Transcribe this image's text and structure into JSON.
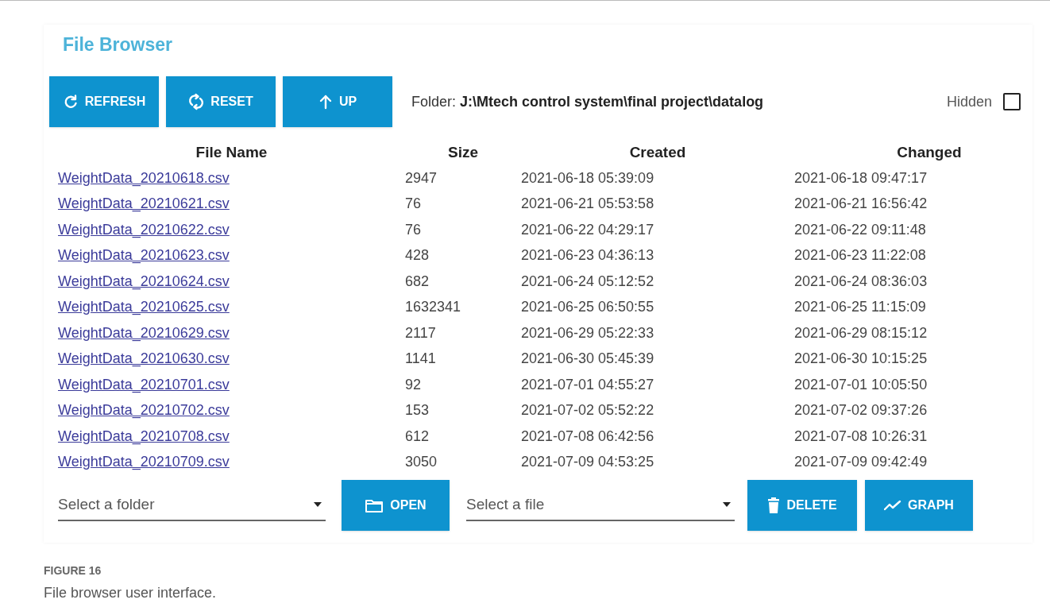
{
  "title": "File Browser",
  "toolbar": [
    {
      "label": "REFRESH"
    },
    {
      "label": "RESET"
    },
    {
      "label": "UP"
    }
  ],
  "folder": {
    "label": "Folder:",
    "path": "J:\\Mtech control system\\final project\\datalog"
  },
  "hidden": {
    "label": "Hidden",
    "checked": false
  },
  "table": {
    "columns": [
      "File Name",
      "Size",
      "Created",
      "Changed"
    ],
    "rows": [
      [
        "WeightData_20210618.csv",
        "2947",
        "2021-06-18 05:39:09",
        "2021-06-18 09:47:17"
      ],
      [
        "WeightData_20210621.csv",
        "76",
        "2021-06-21 05:53:58",
        "2021-06-21 16:56:42"
      ],
      [
        "WeightData_20210622.csv",
        "76",
        "2021-06-22 04:29:17",
        "2021-06-22 09:11:48"
      ],
      [
        "WeightData_20210623.csv",
        "428",
        "2021-06-23 04:36:13",
        "2021-06-23 11:22:08"
      ],
      [
        "WeightData_20210624.csv",
        "682",
        "2021-06-24 05:12:52",
        "2021-06-24 08:36:03"
      ],
      [
        "WeightData_20210625.csv",
        "1632341",
        "2021-06-25 06:50:55",
        "2021-06-25 11:15:09"
      ],
      [
        "WeightData_20210629.csv",
        "2117",
        "2021-06-29 05:22:33",
        "2021-06-29 08:15:12"
      ],
      [
        "WeightData_20210630.csv",
        "1141",
        "2021-06-30 05:45:39",
        "2021-06-30 10:15:25"
      ],
      [
        "WeightData_20210701.csv",
        "92",
        "2021-07-01 04:55:27",
        "2021-07-01 10:05:50"
      ],
      [
        "WeightData_20210702.csv",
        "153",
        "2021-07-02 05:52:22",
        "2021-07-02 09:37:26"
      ],
      [
        "WeightData_20210708.csv",
        "612",
        "2021-07-08 06:42:56",
        "2021-07-08 10:26:31"
      ],
      [
        "WeightData_20210709.csv",
        "3050",
        "2021-07-09 04:53:25",
        "2021-07-09 09:42:49"
      ]
    ]
  },
  "bottom": [
    {
      "kind": "select",
      "placeholder": "Select a folder"
    },
    {
      "kind": "button",
      "label": "OPEN"
    },
    {
      "kind": "select",
      "placeholder": "Select a file"
    },
    {
      "kind": "button",
      "label": "DELETE"
    },
    {
      "kind": "button",
      "label": "GRAPH"
    }
  ],
  "caption": {
    "label": "FIGURE 16",
    "text": "File browser user interface."
  }
}
